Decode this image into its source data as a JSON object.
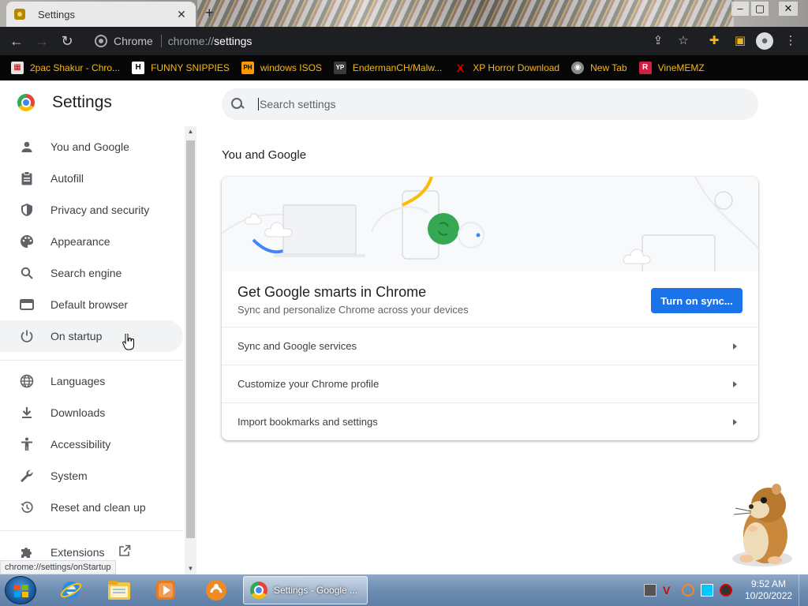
{
  "tab": {
    "title": "Settings",
    "close": "✕",
    "new": "+"
  },
  "window": {
    "minimize": "–",
    "maximize": "▢",
    "close": "✕"
  },
  "omnibox": {
    "chip": "Chrome",
    "scheme": "chrome://",
    "path": "settings"
  },
  "bookmarks": [
    {
      "label": "2pac Shakur - Chro...",
      "icon": "calendar-icon",
      "icon_text": "",
      "color": "#e5e5e5"
    },
    {
      "label": "FUNNY SNIPPIES",
      "icon": "h-icon",
      "icon_text": "H",
      "color": "#ffffff"
    },
    {
      "label": "windows ISOS",
      "icon": "ph-icon",
      "icon_text": "PH",
      "color": "#ff9900"
    },
    {
      "label": "EndermanCH/Malw...",
      "icon": "yp-icon",
      "icon_text": "YP",
      "color": "#3a3a3a"
    },
    {
      "label": "XP Horror Download",
      "icon": "x-icon",
      "icon_text": "X",
      "color": "#d40000"
    },
    {
      "label": "New Tab",
      "icon": "globe-icon",
      "icon_text": "",
      "color": "#999999"
    },
    {
      "label": "VineMEMZ",
      "icon": "r-icon",
      "icon_text": "R",
      "color": "#d02040"
    }
  ],
  "settings": {
    "title": "Settings",
    "search_placeholder": "Search settings",
    "nav": [
      {
        "label": "You and Google",
        "icon": "person-icon"
      },
      {
        "label": "Autofill",
        "icon": "clipboard-icon"
      },
      {
        "label": "Privacy and security",
        "icon": "shield-icon"
      },
      {
        "label": "Appearance",
        "icon": "palette-icon"
      },
      {
        "label": "Search engine",
        "icon": "search-icon"
      },
      {
        "label": "Default browser",
        "icon": "browser-icon"
      },
      {
        "label": "On startup",
        "icon": "power-icon"
      },
      {
        "label": "Languages",
        "icon": "globe-icon"
      },
      {
        "label": "Downloads",
        "icon": "download-icon"
      },
      {
        "label": "Accessibility",
        "icon": "accessibility-icon"
      },
      {
        "label": "System",
        "icon": "wrench-icon"
      },
      {
        "label": "Reset and clean up",
        "icon": "history-icon"
      },
      {
        "label": "Extensions",
        "icon": "puzzle-icon"
      }
    ],
    "section_title": "You and Google",
    "promo_title": "Get Google smarts in Chrome",
    "promo_subtitle": "Sync and personalize Chrome across your devices",
    "sync_button": "Turn on sync...",
    "rows": [
      "Sync and Google services",
      "Customize your Chrome profile",
      "Import bookmarks and settings"
    ]
  },
  "status_url": "chrome://settings/onStartup",
  "taskbar": {
    "active_window": "Settings - Google ...",
    "time": "9:52 AM",
    "date": "10/20/2022"
  },
  "colors": {
    "accent": "#1a73e8",
    "bookmark_text": "#f5b818",
    "toolbar": "#1e1f22"
  }
}
